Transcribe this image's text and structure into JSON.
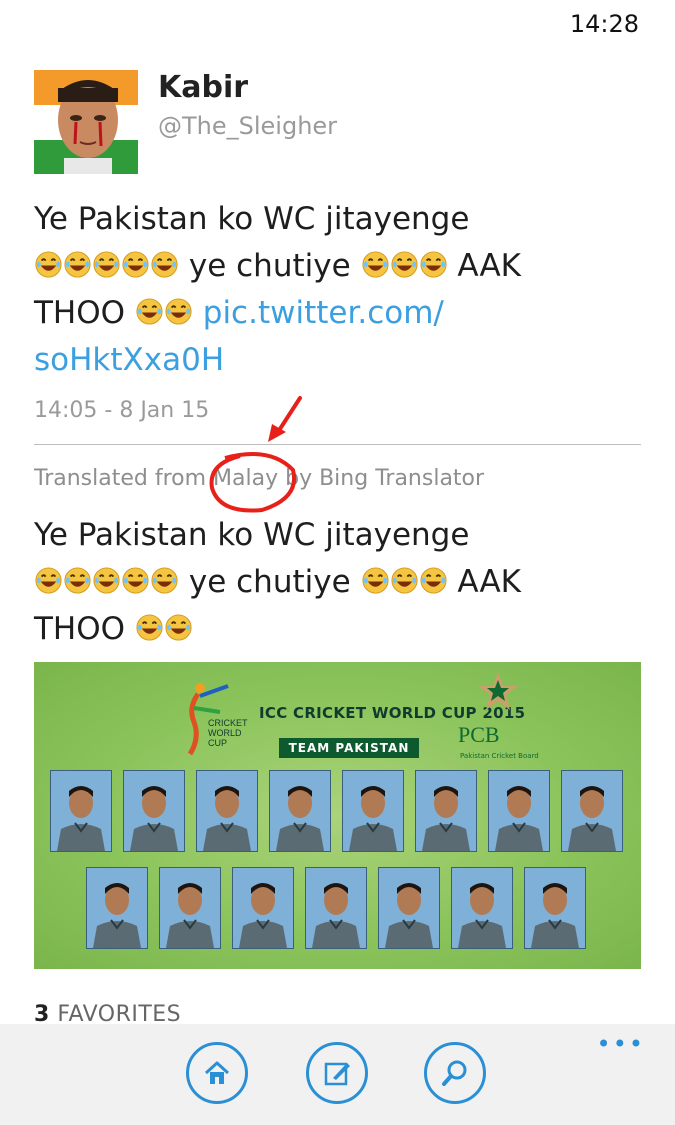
{
  "status_bar": {
    "time": "14:28"
  },
  "tweet": {
    "author_name": "Kabir",
    "author_handle": "@The_Sleigher",
    "line1": "Ye Pakistan ko WC jitayenge",
    "mid_text": " ye chutiye ",
    "aak": " AAK",
    "thoo": "THOO ",
    "link_part1": "pic.twitter.com/",
    "link_part2": "soHktXxa0H",
    "timestamp": "14:05 - 8 Jan 15"
  },
  "translation": {
    "note": "Translated from Malay by Bing Translator",
    "line1": "Ye Pakistan ko WC jitayenge",
    "mid_text": " ye chutiye ",
    "aak": " AAK",
    "thoo": "THOO "
  },
  "media": {
    "title": "ICC CRICKET WORLD CUP 2015",
    "badge": "TEAM PAKISTAN",
    "board": "PCB",
    "board_sub": "Pakistan Cricket Board"
  },
  "favorites": {
    "count": "3",
    "label": "FAVORITES"
  },
  "app_bar": {
    "more": "•••"
  },
  "icons": [
    "home-icon",
    "compose-icon",
    "search-icon"
  ],
  "colors": {
    "link": "#3b9fe0",
    "accent": "#2b8fd6",
    "annotation": "#e8201a"
  }
}
